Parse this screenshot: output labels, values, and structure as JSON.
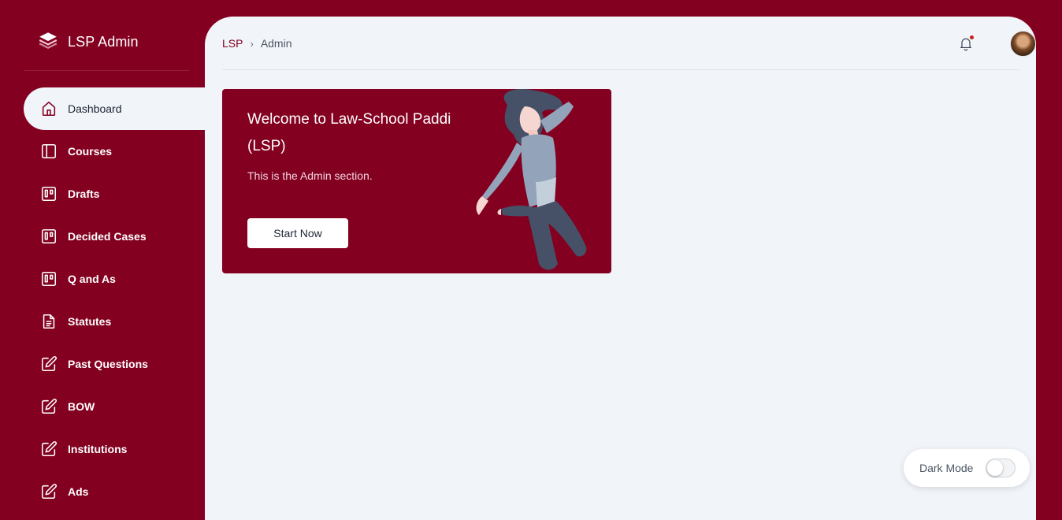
{
  "app": {
    "title": "LSP Admin",
    "logo_icon": "layers-icon"
  },
  "colors": {
    "brand": "#830021",
    "content_bg": "#f1f4f8",
    "notification_dot": "#c81e1e"
  },
  "sidebar": {
    "items": [
      {
        "label": "Dashboard",
        "icon": "home-icon",
        "active": true
      },
      {
        "label": "Courses",
        "icon": "sidebar-panel-icon"
      },
      {
        "label": "Drafts",
        "icon": "kanban-icon"
      },
      {
        "label": "Decided Cases",
        "icon": "kanban-icon"
      },
      {
        "label": "Q and As",
        "icon": "kanban-icon"
      },
      {
        "label": "Statutes",
        "icon": "document-icon"
      },
      {
        "label": "Past Questions",
        "icon": "edit-icon"
      },
      {
        "label": "BOW",
        "icon": "edit-icon"
      },
      {
        "label": "Institutions",
        "icon": "edit-icon"
      },
      {
        "label": "Ads",
        "icon": "edit-icon"
      }
    ]
  },
  "header": {
    "breadcrumb": {
      "root": "LSP",
      "separator": "›",
      "current": "Admin"
    },
    "notification_icon": "bell-icon",
    "has_unread_notifications": true
  },
  "welcome_card": {
    "title": "Welcome to Law-School Paddi (LSP)",
    "subtitle": "This is the Admin section.",
    "button_label": "Start Now"
  },
  "dark_mode": {
    "label": "Dark Mode",
    "enabled": false
  }
}
